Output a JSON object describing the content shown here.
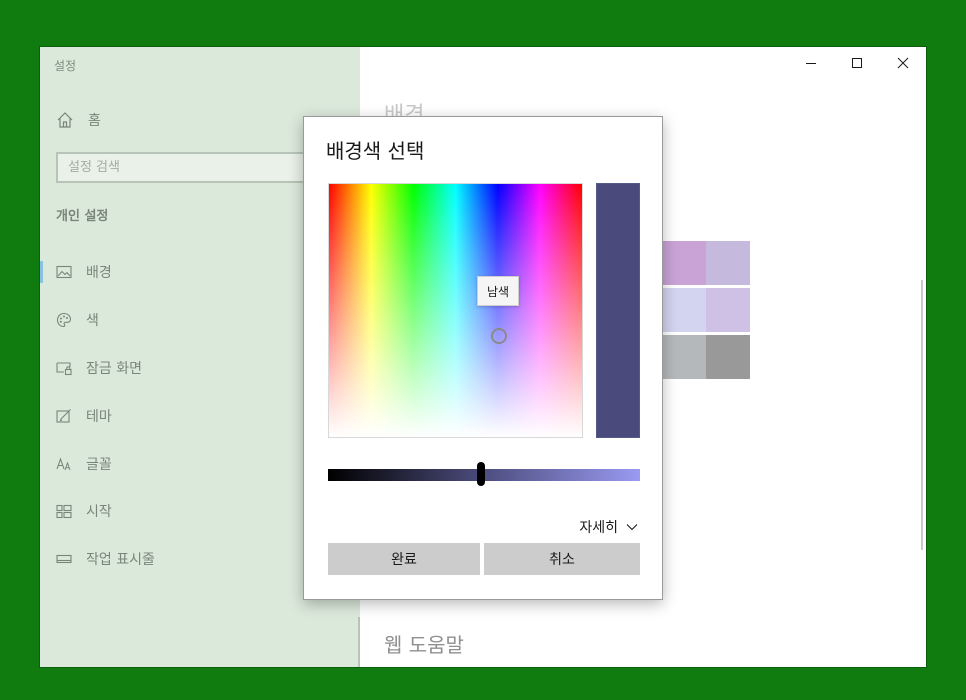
{
  "window": {
    "title": "설정",
    "controls": {
      "minimize": "minimize-icon",
      "maximize": "maximize-icon",
      "close": "close-icon"
    }
  },
  "sidebar": {
    "home_label": "홈",
    "search_placeholder": "설정 검색",
    "section_title": "개인 설정",
    "items": [
      {
        "label": "배경",
        "icon": "picture-icon",
        "active": true
      },
      {
        "label": "색",
        "icon": "palette-icon",
        "active": false
      },
      {
        "label": "잠금 화면",
        "icon": "lock-screen-icon",
        "active": false
      },
      {
        "label": "테마",
        "icon": "theme-icon",
        "active": false
      },
      {
        "label": "글꼴",
        "icon": "font-icon",
        "active": false
      },
      {
        "label": "시작",
        "icon": "start-icon",
        "active": false
      },
      {
        "label": "작업 표시줄",
        "icon": "taskbar-icon",
        "active": false
      }
    ]
  },
  "main": {
    "heading": "배경",
    "web_help": "웹 도움말",
    "swatches": [
      "#c9a3d6",
      "#c6b9de",
      "#d3d4f0",
      "#cfc0e6",
      "#b5b8ba",
      "#999999"
    ]
  },
  "dialog": {
    "title": "배경색 선택",
    "tooltip": "남색",
    "selected_color": "#4b4a7c",
    "brightness_level": 0.49,
    "details_label": "자세히",
    "done_label": "완료",
    "cancel_label": "취소"
  }
}
